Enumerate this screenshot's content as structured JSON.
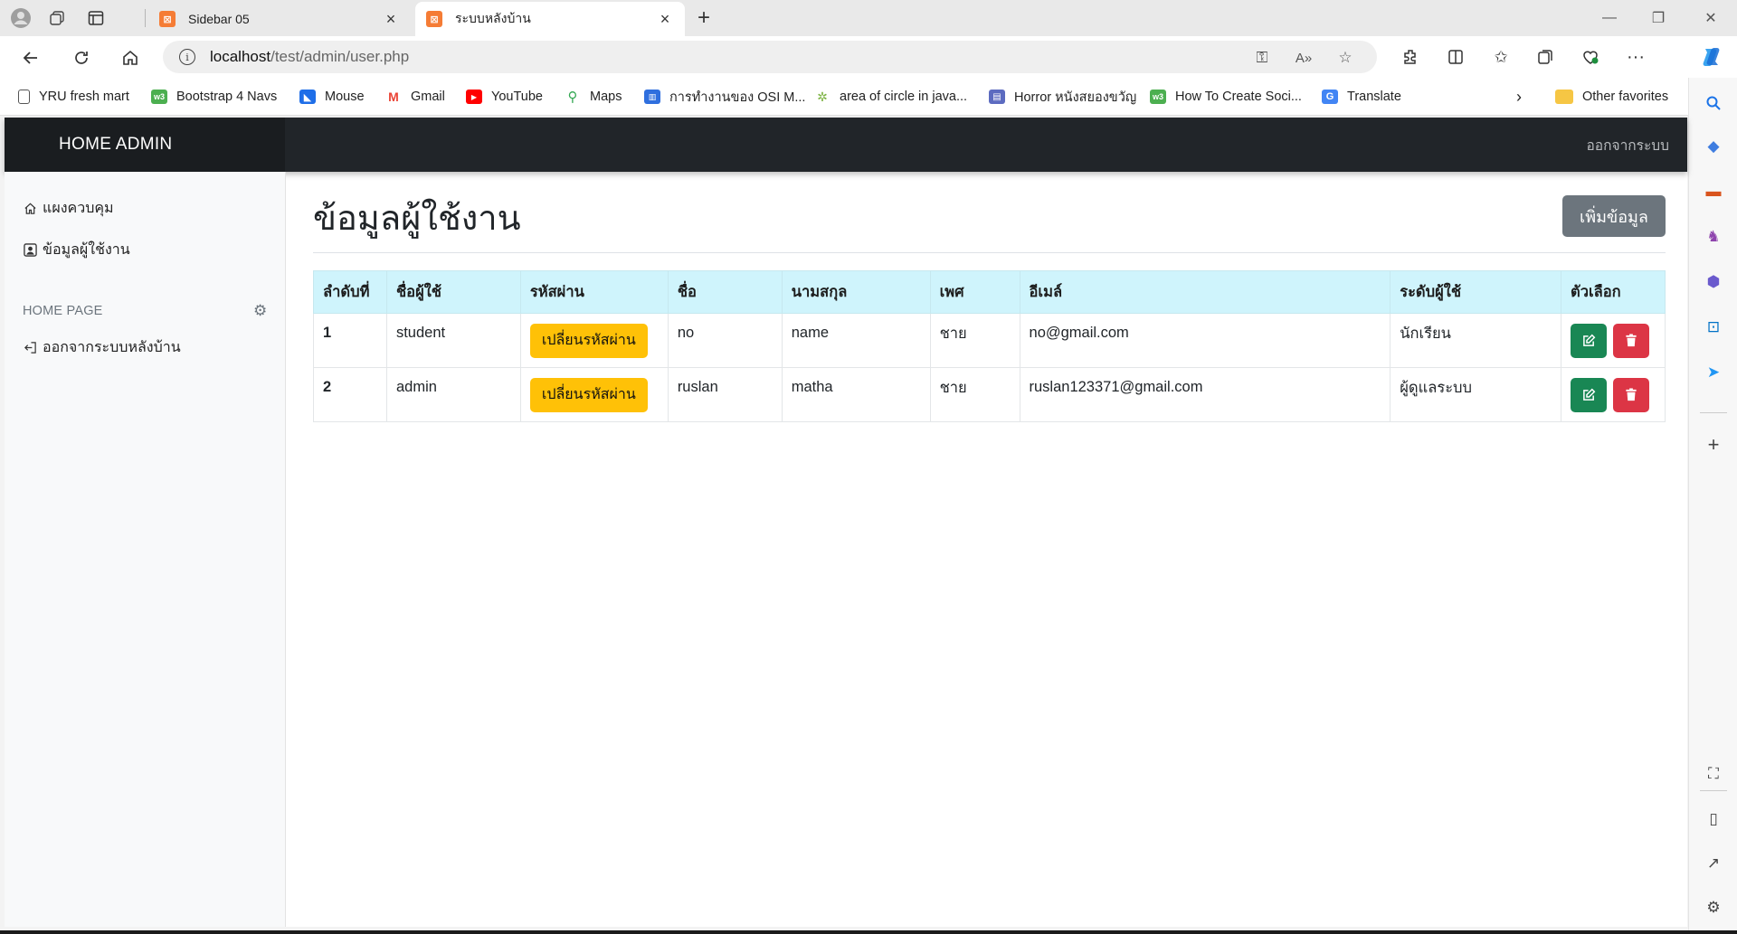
{
  "browser": {
    "tabs": [
      {
        "title": "Sidebar 05",
        "favicon": "xampp-icon",
        "active": false
      },
      {
        "title": "ระบบหลังบ้าน",
        "favicon": "xampp-icon",
        "active": true
      }
    ],
    "address": {
      "host": "localhost",
      "path": "/test/admin/user.php"
    },
    "bookmarks": [
      {
        "label": "YRU fresh mart",
        "icon": "page-icon",
        "color": "#666666"
      },
      {
        "label": "Bootstrap 4 Navs",
        "icon": "w3-icon",
        "color": "#4caf50"
      },
      {
        "label": "Mouse",
        "icon": "mouse-icon",
        "color": "#1e6ee8"
      },
      {
        "label": "Gmail",
        "icon": "gmail-icon",
        "color": "#ea4335"
      },
      {
        "label": "YouTube",
        "icon": "youtube-icon",
        "color": "#ff0000"
      },
      {
        "label": "Maps",
        "icon": "maps-icon",
        "color": "#34a853"
      },
      {
        "label": "การทำงานของ OSI M...",
        "icon": "chart-icon",
        "color": "#2f6fde"
      },
      {
        "label": "area of circle in java...",
        "icon": "sparkle-icon",
        "color": "#7cb342"
      },
      {
        "label": "Horror หนังสยองขวัญ",
        "icon": "film-icon",
        "color": "#5c6bc0"
      },
      {
        "label": "How To Create Soci...",
        "icon": "w3-icon",
        "color": "#4caf50"
      },
      {
        "label": "Translate",
        "icon": "translate-icon",
        "color": "#4285f4"
      }
    ],
    "other_favorites": "Other favorites"
  },
  "nav": {
    "brand": "HOME ADMIN",
    "logout": "ออกจากระบบ"
  },
  "sidebar": {
    "items": [
      {
        "label": "แผงควบคุม",
        "icon": "home-icon"
      },
      {
        "label": "ข้อมูลผู้ใช้งาน",
        "icon": "user-icon"
      }
    ],
    "section_heading": "HOME PAGE",
    "logout_item": {
      "label": "ออกจากระบบหลังบ้าน",
      "icon": "sign-out-icon"
    }
  },
  "main": {
    "title": "ข้อมูลผู้ใช้งาน",
    "add_button": "เพิ่มข้อมูล",
    "table": {
      "headers": [
        "ลำดับที่",
        "ชื่อผู้ใช้",
        "รหัสผ่าน",
        "ชื่อ",
        "นามสกุล",
        "เพศ",
        "อีเมล์",
        "ระดับผู้ใช้",
        "ตัวเลือก"
      ],
      "rows": [
        {
          "no": "1",
          "username": "student",
          "password_button": "เปลี่ยนรหัสผ่าน",
          "first_name": "no",
          "last_name": "name",
          "gender": "ชาย",
          "email": "no@gmail.com",
          "level": "นักเรียน"
        },
        {
          "no": "2",
          "username": "admin",
          "password_button": "เปลี่ยนรหัสผ่าน",
          "first_name": "ruslan",
          "last_name": "matha",
          "gender": "ชาย",
          "email": "ruslan123371@gmail.com",
          "level": "ผู้ดูแลระบบ"
        }
      ]
    }
  },
  "colors": {
    "navbar": "#212529",
    "table_header": "#cff4fc",
    "password_button": "#ffc107",
    "edit_button": "#198754",
    "delete_button": "#dc3545",
    "add_button": "#6c757d"
  }
}
